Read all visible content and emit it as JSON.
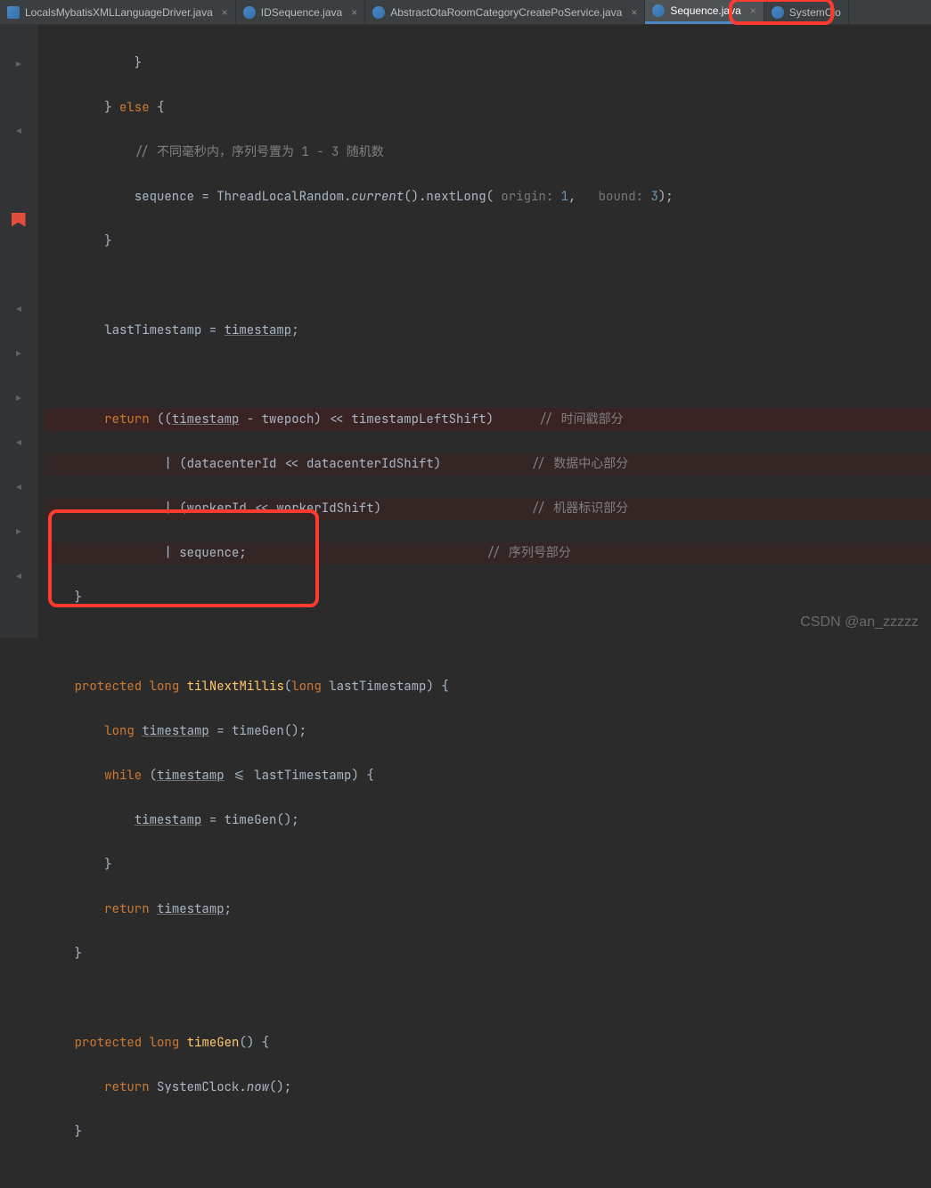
{
  "tabs": [
    {
      "label": "LocalsMybatisXMLLanguageDriver.java",
      "active": false,
      "iconType": "j"
    },
    {
      "label": "IDSequence.java",
      "active": false,
      "iconType": "c"
    },
    {
      "label": "AbstractOtaRoomCategoryCreatePoService.java",
      "active": false,
      "iconType": "c"
    },
    {
      "label": "Sequence.java",
      "active": true,
      "iconType": "c"
    },
    {
      "label": "SystemClo",
      "active": false,
      "iconType": "c"
    }
  ],
  "code": {
    "l1": "            }",
    "l2a": "        } ",
    "l2b": "else",
    "l2c": " {",
    "l3": "            // 不同毫秒内，序列号置为 1 - 3 随机数",
    "l4a": "            sequence = ThreadLocalRandom.",
    "l4b": "current",
    "l4c": "().nextLong( ",
    "h1": "origin:",
    "n1": "1",
    "h2": "bound:",
    "n2": "3",
    "l4d": ");",
    "l5": "        }",
    "l7a": "        lastTimestamp = ",
    "l7b": "timestamp",
    "l7c": ";",
    "l9a": "        ",
    "kw_return": "return",
    "l9b": " ((",
    "l9c": "timestamp",
    "l9d": " - twepoch) << timestampLeftShift)",
    "c9": " // 时间戳部分",
    "l10": "                | (datacenterId << datacenterIdShift)",
    "c10": "// 数据中心部分",
    "l11": "                | (workerId << workerIdShift)",
    "c11": "// 机器标识部分",
    "l12": "                | sequence;",
    "c12": "// 序列号部分",
    "l13": "    }",
    "l15a": "    ",
    "kw_protected": "protected",
    "sp": " ",
    "kw_long": "long",
    "l15b": " ",
    "m1": "tilNextMillis",
    "l15c": "(",
    "kw_long2": "long",
    "l15d": " lastTimestamp) {",
    "l16a": "        ",
    "kw_long3": "long",
    "l16b": " ",
    "u1": "timestamp",
    "l16c": " = timeGen();",
    "l17a": "        ",
    "kw_while": "while",
    "l17b": " (",
    "u2": "timestamp",
    "l17c": " <= lastTimestamp) {",
    "l18a": "            ",
    "u3": "timestamp",
    "l18b": " = timeGen();",
    "l19": "        }",
    "l20a": "        ",
    "kw_return2": "return",
    "l20b": " ",
    "u4": "timestamp",
    "l20c": ";",
    "l21": "    }",
    "l23a": "    ",
    "kw_protected2": "protected",
    "l23b": " ",
    "kw_long4": "long",
    "l23c": " ",
    "m2": "timeGen",
    "l23d": "() {",
    "l24a": "        ",
    "kw_return3": "return",
    "l24b": " SystemClock.",
    "it": "now",
    "l24c": "();",
    "l25": "    }"
  },
  "watermark": "CSDN @an_zzzzz"
}
